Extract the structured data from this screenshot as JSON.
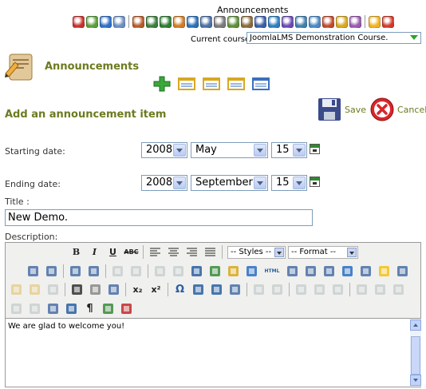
{
  "top": {
    "title": "Announcements",
    "course_label": "Current course:",
    "course_value": "JoomlaLMS Demonstration Course."
  },
  "top_icons": [
    {
      "name": "home-icon",
      "color": "#c9302c"
    },
    {
      "name": "course-home-icon",
      "color": "#5a9e3a"
    },
    {
      "name": "info-icon",
      "color": "#2f6fc9"
    },
    {
      "name": "documents-icon",
      "color": "#6b8fc4"
    },
    {
      "sep": true
    },
    {
      "name": "homework-icon",
      "color": "#b85a2a"
    },
    {
      "name": "calendar-icon",
      "color": "#3b7d3b"
    },
    {
      "name": "links-icon",
      "color": "#2e7d32"
    },
    {
      "name": "learning-path-icon",
      "color": "#d17b24"
    },
    {
      "name": "quiz-icon",
      "color": "#2a6fb8"
    },
    {
      "name": "attendance-icon",
      "color": "#4a6fa5"
    },
    {
      "name": "gradebook-icon",
      "color": "#7a7a7a"
    },
    {
      "name": "tracking-icon",
      "color": "#5c8f3a"
    },
    {
      "name": "dropbox-icon",
      "color": "#8a6a3a"
    },
    {
      "name": "users-icon",
      "color": "#3a5fa8"
    },
    {
      "name": "chat-icon",
      "color": "#2d7dbf"
    },
    {
      "name": "conference-icon",
      "color": "#6a4ab5"
    },
    {
      "name": "forum-icon",
      "color": "#3f7fb0"
    },
    {
      "name": "search-icon",
      "color": "#4a88c5"
    },
    {
      "name": "reports-icon",
      "color": "#c04a2a"
    },
    {
      "name": "mail-icon",
      "color": "#d8a821"
    },
    {
      "name": "settings-icon",
      "color": "#9a5ab0"
    },
    {
      "sep": true
    },
    {
      "name": "favorites-icon",
      "color": "#f2b321"
    },
    {
      "name": "help-icon",
      "color": "#d23a2a"
    }
  ],
  "header": {
    "title": "Announcements"
  },
  "actions": [
    {
      "name": "add-icon",
      "color": "#3aa83a"
    },
    {
      "name": "list-view-icon",
      "color": "#d8a821"
    },
    {
      "name": "month-view-icon",
      "color": "#d8a821"
    },
    {
      "name": "week-view-icon",
      "color": "#d8a821"
    },
    {
      "name": "day-view-icon",
      "color": "#3a6fc0"
    }
  ],
  "form": {
    "title": "Add an announcement item",
    "save_label": "Save",
    "cancel_label": "Cancel",
    "start_label": "Starting date:",
    "start_year": "2008",
    "start_month": "May",
    "start_day": "15",
    "end_label": "Ending date:",
    "end_year": "2008",
    "end_month": "September",
    "end_day": "15",
    "title_label": "Title :",
    "title_value": "New Demo.",
    "description_label": "Description:"
  },
  "editor": {
    "styles_label": "-- Styles --",
    "format_label": "-- Format --",
    "content": "We are glad to welcome you!",
    "bold": "B",
    "italic": "I",
    "underline": "U",
    "strike": "ABC",
    "subscript": "x₂",
    "superscript": "x²",
    "omega": "Ω",
    "pilcrow": "¶",
    "html": "HTML"
  },
  "colors": {
    "accent": "#6d7a1f",
    "border": "#7f9db9"
  }
}
